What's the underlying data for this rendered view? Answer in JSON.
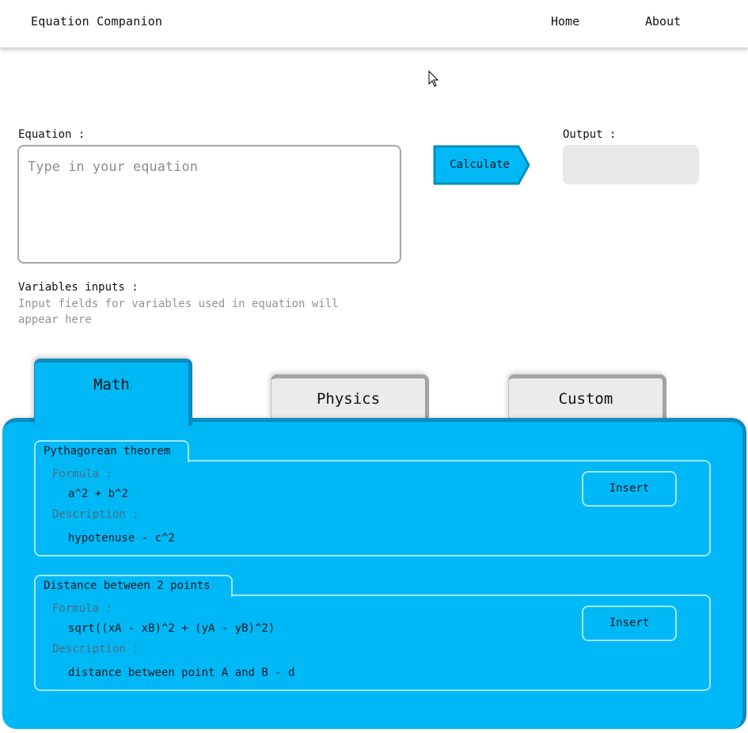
{
  "navbar": {
    "brand": "Equation Companion",
    "links": [
      {
        "label": "Home"
      },
      {
        "label": "About"
      }
    ]
  },
  "equation": {
    "label": "Equation :",
    "placeholder": "Type in your equation",
    "value": ""
  },
  "calculate": {
    "label": "Calculate"
  },
  "output": {
    "label": "Output :",
    "value": ""
  },
  "variables": {
    "label": "Variables inputs :",
    "hint": "Input fields for variables used in equation will appear here"
  },
  "tabs": [
    {
      "label": "Math",
      "active": true
    },
    {
      "label": "Physics",
      "active": false
    },
    {
      "label": "Custom",
      "active": false
    }
  ],
  "formulas": [
    {
      "title": "Pythagorean theorem",
      "formula_label": "Formula :",
      "formula": "a^2 + b^2",
      "description_label": "Description :",
      "description": "hypotenuse - c^2",
      "insert_label": "Insert"
    },
    {
      "title": "Distance between 2 points",
      "formula_label": "Formula :",
      "formula": "sqrt((xA - xB)^2 + (yA - yB)^2)",
      "description_label": "Description :",
      "description": "distance between point A and B - d",
      "insert_label": "Insert"
    }
  ],
  "colors": {
    "accent": "#00b8f6",
    "accent_dark": "#0a8cbd",
    "card_border": "#9fe6ff",
    "inactive_tab": "#ebebeb",
    "output_bg": "#e9e9e9"
  }
}
